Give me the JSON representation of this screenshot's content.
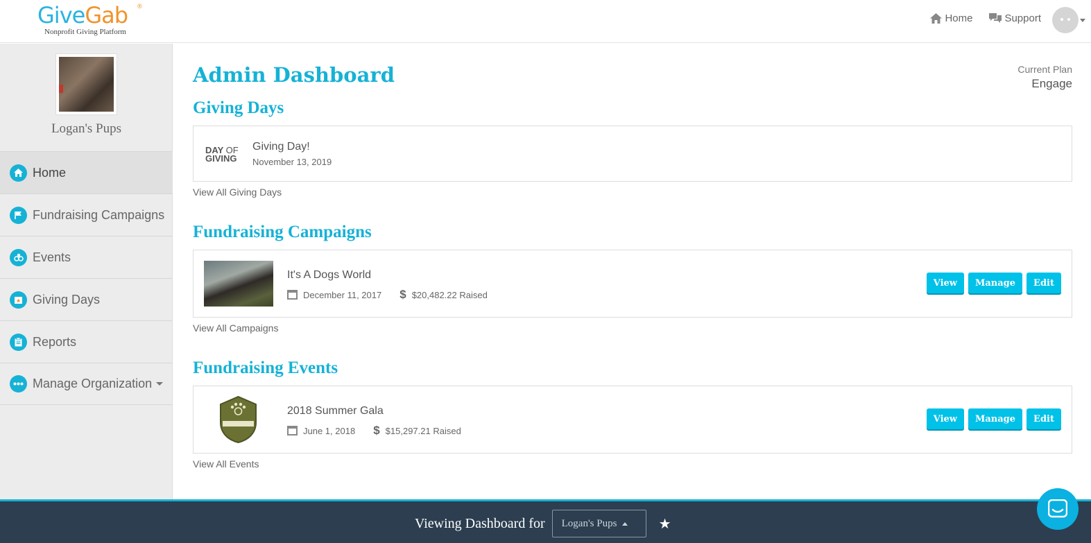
{
  "header": {
    "logo": {
      "brand_part1": "Give",
      "brand_part2": "Gab",
      "registered": "®",
      "tagline": "Nonprofit Giving Platform"
    },
    "nav": {
      "home": "Home",
      "support": "Support"
    }
  },
  "sidebar": {
    "org_name": "Logan's Pups",
    "items": [
      {
        "label": "Home",
        "icon": "home-icon",
        "active": true
      },
      {
        "label": "Fundraising Campaigns",
        "icon": "flag-icon"
      },
      {
        "label": "Events",
        "icon": "people-icon"
      },
      {
        "label": "Giving Days",
        "icon": "calendar-star-icon"
      },
      {
        "label": "Reports",
        "icon": "clipboard-icon"
      },
      {
        "label": "Manage Organization",
        "icon": "more-icon",
        "has_dropdown": true
      }
    ]
  },
  "main": {
    "title": "Admin Dashboard",
    "plan": {
      "label": "Current Plan",
      "value": "Engage"
    },
    "giving_days": {
      "title": "Giving Days",
      "badge": {
        "line1a": "DAY",
        "line1b": "OF",
        "line2": "GIVING"
      },
      "item": {
        "name": "Giving Day!",
        "date": "November 13, 2019"
      },
      "view_all": "View All Giving Days"
    },
    "campaigns": {
      "title": "Fundraising Campaigns",
      "item": {
        "name": "It's A Dogs World",
        "date": "December 11, 2017",
        "raised": "$20,482.22 Raised"
      },
      "view_all": "View All Campaigns"
    },
    "events": {
      "title": "Fundraising Events",
      "item": {
        "name": "2018 Summer Gala",
        "date": "June 1, 2018",
        "raised": "$15,297.21 Raised"
      },
      "view_all": "View All Events"
    },
    "buttons": {
      "view": "View",
      "manage": "Manage",
      "edit": "Edit"
    }
  },
  "footer": {
    "label": "Viewing Dashboard for",
    "selected_org": "Logan's Pups"
  },
  "colors": {
    "accent": "#16b2d6",
    "button": "#00c1e8",
    "footer_bg": "#2c3e50"
  }
}
